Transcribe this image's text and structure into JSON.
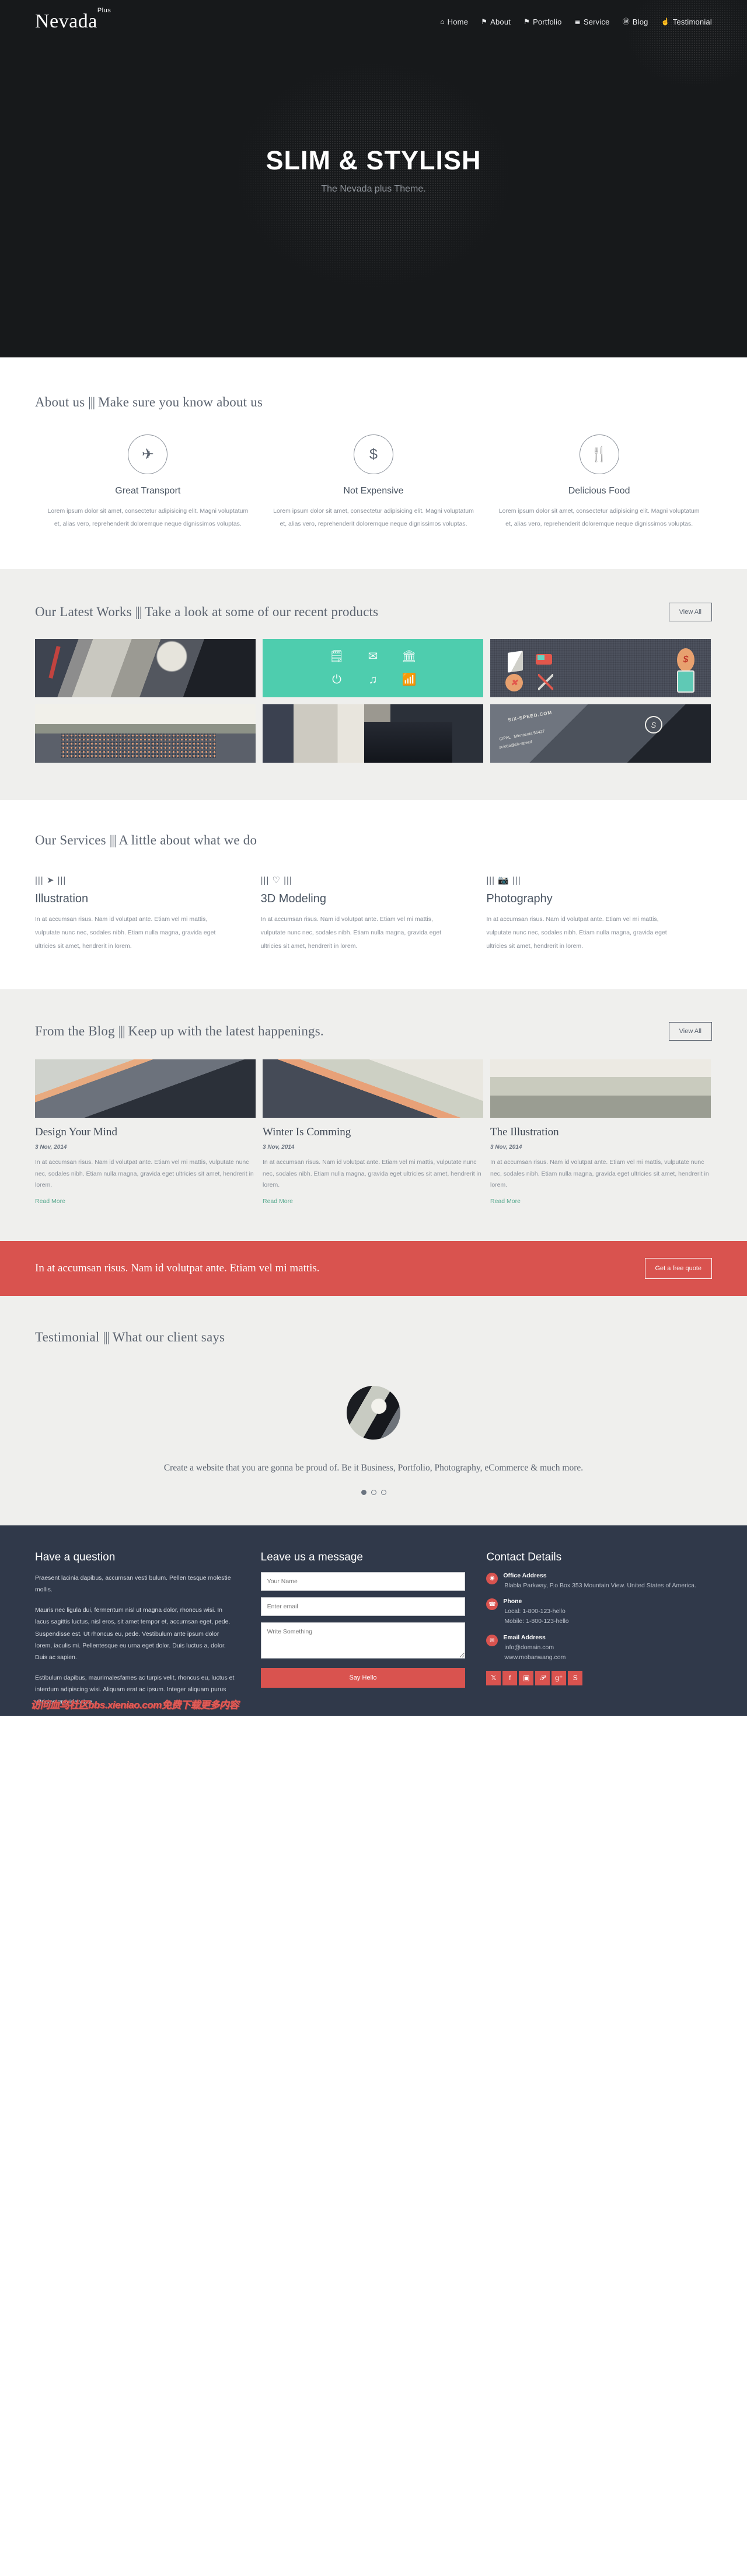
{
  "header": {
    "logo": "Nevada",
    "logo_sup": "Plus",
    "nav": [
      {
        "label": "Home",
        "icon": "home-icon",
        "glyph": "⌂"
      },
      {
        "label": "About",
        "icon": "bookmark-icon",
        "glyph": "⚑"
      },
      {
        "label": "Portfolio",
        "icon": "bookmark-icon",
        "glyph": "⚑"
      },
      {
        "label": "Service",
        "icon": "list-icon",
        "glyph": "≣"
      },
      {
        "label": "Blog",
        "icon": "wordpress-icon",
        "glyph": "Ⓦ"
      },
      {
        "label": "Testimonial",
        "icon": "thumbs-up-icon",
        "glyph": "☝"
      }
    ]
  },
  "hero": {
    "title": "SLIM & STYLISH",
    "subtitle": "The Nevada plus Theme."
  },
  "about": {
    "title_main": "About us",
    "title_bars": "|||",
    "title_sub": "Make sure you know about us",
    "columns": [
      {
        "icon": "airplane-icon",
        "glyph": "✈",
        "heading": "Great Transport",
        "text": "Lorem ipsum dolor sit amet, consectetur adipisicing elit. Magni voluptatum et, alias vero, reprehenderit doloremque neque dignissimos voluptas."
      },
      {
        "icon": "dollar-icon",
        "glyph": "$",
        "heading": "Not Expensive",
        "text": "Lorem ipsum dolor sit amet, consectetur adipisicing elit. Magni voluptatum et, alias vero, reprehenderit doloremque neque dignissimos voluptas."
      },
      {
        "icon": "cutlery-icon",
        "glyph": "🍴",
        "heading": "Delicious Food",
        "text": "Lorem ipsum dolor sit amet, consectetur adipisicing elit. Magni voluptatum et, alias vero, reprehenderit doloremque neque dignissimos voluptas."
      }
    ]
  },
  "portfolio": {
    "title_main": "Our Latest Works",
    "title_bars": "|||",
    "title_sub": "Take a look at some of our recent products",
    "view_all": "View All",
    "tiles": [
      {
        "name": "mason-jar-photo"
      },
      {
        "name": "teal-line-icons-graphic"
      },
      {
        "name": "flat-icons-graphic"
      },
      {
        "name": "forest-logs-photo"
      },
      {
        "name": "bicycle-street-photo"
      },
      {
        "name": "business-card-photo"
      }
    ],
    "teal_icons": [
      "🗒",
      "✉",
      "🏛",
      "⏻",
      "♫",
      "📶"
    ]
  },
  "services": {
    "title_main": "Our Services",
    "title_bars": "|||",
    "title_sub": "A little about what we do",
    "items": [
      {
        "icon": "paper-plane-icon",
        "glyph": "➤",
        "heading": "Illustration",
        "text": "In at accumsan risus. Nam id volutpat ante. Etiam vel mi mattis, vulputate nunc nec, sodales nibh. Etiam nulla magna, gravida eget ultricies sit amet, hendrerit in lorem."
      },
      {
        "icon": "heart-icon",
        "glyph": "♡",
        "heading": "3D Modeling",
        "text": "In at accumsan risus. Nam id volutpat ante. Etiam vel mi mattis, vulputate nunc nec, sodales nibh. Etiam nulla magna, gravida eget ultricies sit amet, hendrerit in lorem."
      },
      {
        "icon": "camera-icon",
        "glyph": "📷",
        "heading": "Photography",
        "text": "In at accumsan risus. Nam id volutpat ante. Etiam vel mi mattis, vulputate nunc nec, sodales nibh. Etiam nulla magna, gravida eget ultricies sit amet, hendrerit in lorem."
      }
    ]
  },
  "blog": {
    "title_main": "From the Blog",
    "title_bars": "|||",
    "title_sub": "Keep up with the latest happenings.",
    "view_all": "View All",
    "posts": [
      {
        "title": "Design Your Mind",
        "date": "3 Nov, 2014",
        "excerpt": "In at accumsan risus. Nam id volutpat ante. Etiam vel mi mattis, vulputate nunc nec, sodales nibh. Etiam nulla magna, gravida eget ultricies sit amet, hendrerit in lorem.",
        "read_more": "Read More"
      },
      {
        "title": "Winter Is Comming",
        "date": "3 Nov, 2014",
        "excerpt": "In at accumsan risus. Nam id volutpat ante. Etiam vel mi mattis, vulputate nunc nec, sodales nibh. Etiam nulla magna, gravida eget ultricies sit amet, hendrerit in lorem.",
        "read_more": "Read More"
      },
      {
        "title": "The Illustration",
        "date": "3 Nov, 2014",
        "excerpt": "In at accumsan risus. Nam id volutpat ante. Etiam vel mi mattis, vulputate nunc nec, sodales nibh. Etiam nulla magna, gravida eget ultricies sit amet, hendrerit in lorem.",
        "read_more": "Read More"
      }
    ]
  },
  "cta": {
    "text": "In at accumsan risus. Nam id volutpat ante. Etiam vel mi mattis.",
    "button": "Get a free quote",
    "color": "#d9534f"
  },
  "testimonial": {
    "title_main": "Testimonial",
    "title_bars": "|||",
    "title_sub": "What our client says",
    "avatar": "client-portrait",
    "quote": "Create a website that you are gonna be proud of. Be it Business, Portfolio, Photography, eCommerce & much more.",
    "slides": 3,
    "active_slide": 1
  },
  "footer": {
    "question": {
      "heading": "Have a question",
      "p1": "Praesent lacinia dapibus, accumsan vesti bulum. Pellen tesque molestie mollis.",
      "p2": "Mauris nec ligula dui, fermentum nisl ut magna dolor, rhoncus wisi. In lacus sagittis luctus, nisl eros, sit amet tempor et, accumsan eget, pede. Suspendisse est. Ut rhoncus eu, pede. Vestibulum ante ipsum dolor lorem, iaculis mi. Pellentesque eu urna eget dolor. Duis luctus a, dolor. Duis ac sapien.",
      "p3": "Estibulum dapibus, maurimalesfames ac turpis velit, rhoncus eu, luctus et interdum adipiscing wisi. Aliquam erat ac ipsum. Integer aliquam purus ultricies gravida vitae..."
    },
    "message": {
      "heading": "Leave us a message",
      "name_placeholder": "Your Name",
      "email_placeholder": "Enter email",
      "body_placeholder": "Write Something",
      "submit": "Say Hello"
    },
    "contact": {
      "heading": "Contact Details",
      "rows": [
        {
          "icon": "map-marker-icon",
          "glyph": "◉",
          "label": "Office Address",
          "value": "Blabla Parkway, P.o Box 353 Mountain View. United States of America."
        },
        {
          "icon": "phone-icon",
          "glyph": "☎",
          "label": "Phone",
          "value": "Local: 1-800-123-hello\nMobile: 1-800-123-hello"
        },
        {
          "icon": "envelope-icon",
          "glyph": "✉",
          "label": "Email Address",
          "value": "info@domain.com\nwww.mobanwang.com"
        }
      ],
      "socials": [
        {
          "name": "twitter-icon",
          "glyph": "𝕏"
        },
        {
          "name": "facebook-icon",
          "glyph": "f"
        },
        {
          "name": "instagram-icon",
          "glyph": "▣"
        },
        {
          "name": "pinterest-icon",
          "glyph": "𝒫"
        },
        {
          "name": "google-plus-icon",
          "glyph": "g⁺"
        },
        {
          "name": "skype-icon",
          "glyph": "S"
        }
      ]
    },
    "watermark": "访问血鸟社区bbs.xieniao.com免费下载更多内容"
  }
}
